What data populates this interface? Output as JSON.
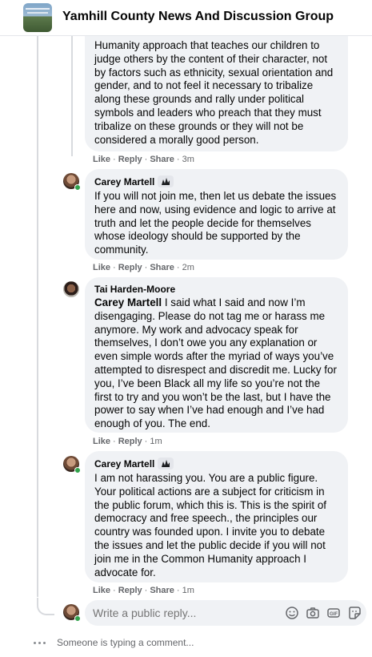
{
  "header": {
    "group_name": "Yamhill County News And Discussion Group"
  },
  "comments": [
    {
      "author": "",
      "text": "Humanity approach that teaches our children to judge others by the content of their character, not by factors such as ethnicity, sexual orientation and gender, and to not feel it necessary to tribalize along these grounds and rally under political symbols and leaders who preach that they must tribalize on these grounds or they will not be considered a morally good person.",
      "actions": {
        "like": "Like",
        "reply": "Reply",
        "share": "Share",
        "time": "3m"
      }
    },
    {
      "author": "Carey Martell",
      "text": "If you will not join me, then let us debate the issues here and now, using evidence and logic to arrive at truth and let the people decide for themselves whose ideology should be supported by the community.",
      "actions": {
        "like": "Like",
        "reply": "Reply",
        "share": "Share",
        "time": "2m"
      }
    },
    {
      "author": "Tai Harden-Moore",
      "mention": "Carey Martell",
      "text": " I said what I said and now I’m disengaging. Please do not tag me or harass me anymore. My work and advocacy speak for themselves, I don’t owe you any explanation or even simple words after the myriad of ways you’ve attempted to disrespect and discredit me. Lucky for you, I’ve been Black all my life so you’re not the first to try and you won’t be the last, but I have the power to say when I’ve had enough and I’ve had enough of you. The end.",
      "actions": {
        "like": "Like",
        "reply": "Reply",
        "time": "1m"
      }
    },
    {
      "author": "Carey Martell",
      "text": "I am not harassing you. You are a public figure. Your political actions are a subject for criticism in the public forum, which this is. This is the spirit of democracy and free speech., the principles our country was founded upon. I invite you to debate the issues and let the public decide if you will not join me in the Common Humanity approach I advocate for.",
      "actions": {
        "like": "Like",
        "reply": "Reply",
        "share": "Share",
        "time": "1m"
      }
    }
  ],
  "composer": {
    "placeholder": "Write a public reply...",
    "icons": [
      "emoji-icon",
      "camera-icon",
      "gif-icon",
      "sticker-icon"
    ]
  },
  "typing_indicator": "Someone is typing a comment...",
  "colors": {
    "bubble": "#f0f2f5",
    "secondary_text": "#65676b",
    "online": "#31a24c",
    "thread_line": "#d8dade"
  }
}
